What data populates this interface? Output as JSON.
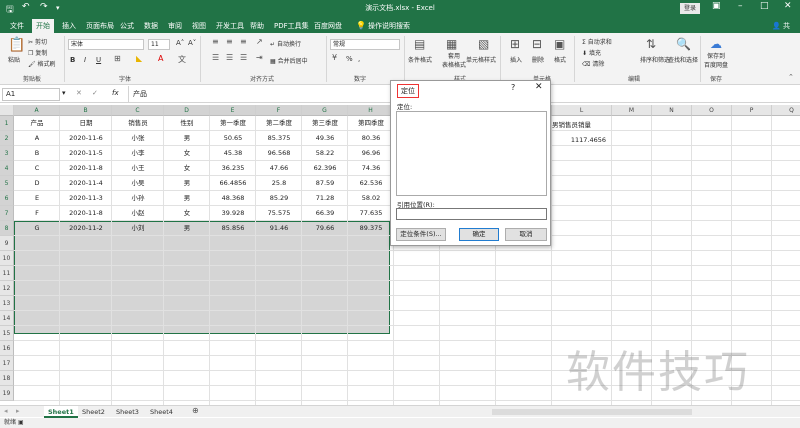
{
  "titlebar": {
    "title": "演示文档.xlsx - Excel",
    "login": "登录",
    "save_icon": "save-icon",
    "undo_icon": "undo-icon",
    "redo_icon": "redo-icon"
  },
  "tabs": [
    "文件",
    "开始",
    "插入",
    "页面布局",
    "公式",
    "数据",
    "审阅",
    "视图",
    "开发工具",
    "帮助",
    "PDF工具集",
    "百度网盘",
    "操作说明搜索"
  ],
  "share_label": "共享",
  "ribbon": {
    "clipboard": {
      "paste": "粘贴",
      "cut": "剪切",
      "copy": "复制",
      "format_painter": "格式刷",
      "group": "剪贴板"
    },
    "font": {
      "name": "宋体",
      "size": "11",
      "bold": "B",
      "italic": "I",
      "underline": "U",
      "group": "字体"
    },
    "align": {
      "wrap": "自动换行",
      "merge": "合并后居中",
      "group": "对齐方式"
    },
    "number": {
      "format": "常规",
      "percent": "%",
      "comma": ",",
      "group": "数字"
    },
    "styles": {
      "conditional": "条件格式",
      "table": "套用\n表格格式",
      "cell_styles": "单元格样式",
      "group": "样式"
    },
    "cells": {
      "insert": "插入",
      "delete": "删除",
      "format": "格式",
      "group": "单元格"
    },
    "editing": {
      "autosum": "自动求和",
      "fill": "填充",
      "clear": "清除",
      "sort": "排序和筛选",
      "find": "查找和选择",
      "group": "编辑"
    },
    "save": {
      "label": "保存到\n百度网盘",
      "group": "保存"
    }
  },
  "formula_bar": {
    "name_box": "A1",
    "fx": "fx",
    "content": "产品"
  },
  "columns": [
    "A",
    "B",
    "C",
    "D",
    "E",
    "F",
    "G",
    "H",
    "I",
    "J",
    "K",
    "L",
    "M",
    "N",
    "O",
    "P",
    "Q"
  ],
  "rows": [
    "1",
    "2",
    "3",
    "4",
    "5",
    "6",
    "7",
    "8",
    "9",
    "10",
    "11",
    "12",
    "13",
    "14",
    "15",
    "16",
    "17",
    "18",
    "19"
  ],
  "table": {
    "headers": [
      "产品",
      "日期",
      "销售员",
      "性别",
      "第一季度",
      "第二季度",
      "第三季度",
      "第四季度"
    ],
    "rows": [
      [
        "A",
        "2020-11-6",
        "小张",
        "男",
        "50.65",
        "85.375",
        "49.36",
        "80.36"
      ],
      [
        "B",
        "2020-11-5",
        "小李",
        "女",
        "45.38",
        "96.568",
        "58.22",
        "96.96"
      ],
      [
        "C",
        "2020-11-8",
        "小王",
        "女",
        "36.235",
        "47.66",
        "62.396",
        "74.36"
      ],
      [
        "D",
        "2020-11-4",
        "小吴",
        "男",
        "66.4856",
        "25.8",
        "87.59",
        "62.536"
      ],
      [
        "E",
        "2020-11-3",
        "小孙",
        "男",
        "48.368",
        "85.29",
        "71.28",
        "58.02"
      ],
      [
        "F",
        "2020-11-8",
        "小赵",
        "女",
        "39.928",
        "75.575",
        "66.39",
        "77.635"
      ],
      [
        "G",
        "2020-11-2",
        "小刘",
        "男",
        "85.856",
        "91.46",
        "79.66",
        "89.375"
      ]
    ]
  },
  "side_label": "男销售员销量",
  "side_value": "1117.4656",
  "dialog": {
    "title": "定位",
    "help": "?",
    "close": "✕",
    "goto_label": "定位:",
    "ref_label": "引用位置(R):",
    "ref_value": "",
    "special_button": "定位条件(S)...",
    "ok_button": "确定",
    "cancel_button": "取消"
  },
  "sheets": [
    "Sheet1",
    "Sheet2",
    "Sheet3",
    "Sheet4"
  ],
  "status": "就绪",
  "watermark": "软件技巧"
}
